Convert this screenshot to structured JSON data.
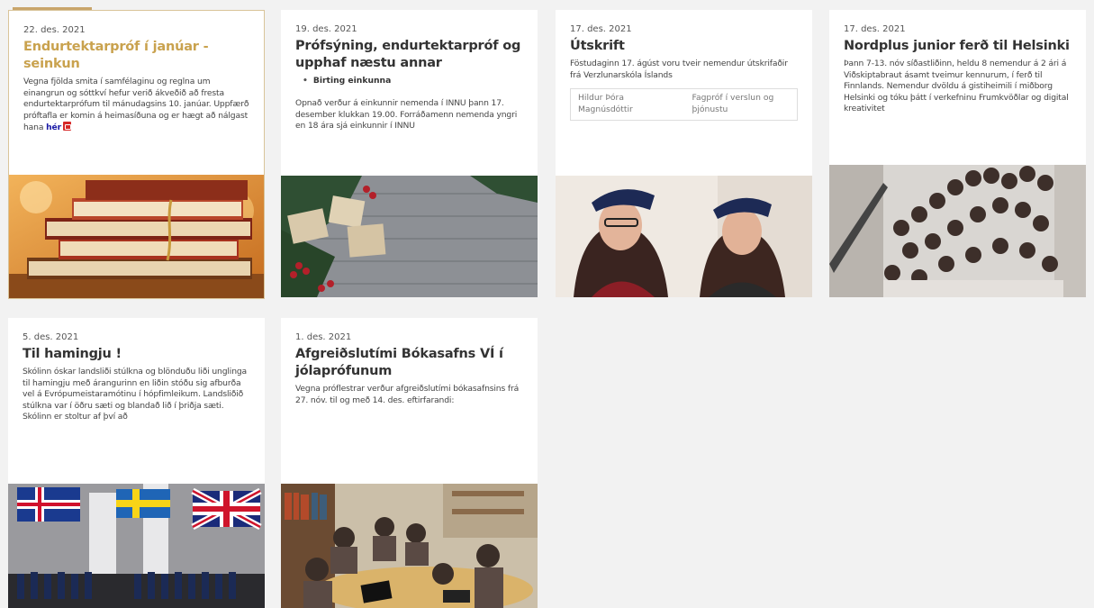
{
  "news": [
    {
      "date": "22. des. 2021",
      "title": "Endurtektarpróf í janúar - seinkun",
      "text": "Vegna fjölda smita í samfélaginu og reglna um einangrun og sóttkví hefur verið ákveðið að fresta endurtektarprófum til mánudagsins 10. janúar. Uppfærð próftafla er komin á heimasíðuna og er hægt að nálgast hana",
      "link_label": "hér",
      "image_icon": "books-icon"
    },
    {
      "date": "19. des. 2021",
      "title": "Prófsýning, endurtektarpróf og upphaf næstu annar",
      "bullet": "Birting einkunna",
      "text": "Opnað verður á einkunnir nemenda í INNU þann 17. desember klukkan 19.00. Forráðamenn nemenda yngri en 18 ára sjá einkunnir í INNU",
      "image_icon": "christmas-gifts-icon"
    },
    {
      "date": "17. des. 2021",
      "title": "Útskrift",
      "text": "Föstudaginn 17. ágúst voru tveir nemendur útskrifaðir frá Verzlunarskóla Íslands",
      "table": [
        [
          "Hildur Þóra",
          "Fagpróf í verslun og"
        ],
        [
          "Magnúsdóttir",
          "þjónustu"
        ]
      ],
      "image_icon": "graduates-icon"
    },
    {
      "date": "17. des. 2021",
      "title": "Nordplus junior ferð til Helsinki",
      "text": "Þann 7-13. nóv síðastliðinn, heldu 8 nemendur á 2 ári á Viðskiptabraut ásamt tveimur kennurum, í ferð til Finnlands. Nemendur dvöldu á gistiheimili í miðborg Helsinki og tóku þátt í verkefninu Frumkvöðlar og digital kreativitet",
      "image_icon": "group-photo-icon"
    },
    {
      "date": "5. des. 2021",
      "title": "Til hamingju !",
      "text": "Skólinn óskar landsliði stúlkna og blönduðu liði unglinga til hamingju með árangurinn en liðin stóðu sig afburða vel á Evrópumeistaramótinu í hópfimleikum. Landsliðið stúlkna var í öðru sæti og blandað lið í þriðja sæti. Skólinn er stoltur af því að",
      "image_icon": "flags-gymnastics-icon"
    },
    {
      "date": "1. des. 2021",
      "title": "Afgreiðslutími Bókasafns VÍ í jólaprófunum",
      "text": "Vegna próflestrar verður afgreiðslutími bókasafnsins frá 27. nóv. til og með 14. des. eftirfarandi:",
      "image_icon": "library-students-icon"
    }
  ],
  "colors": {
    "accent": "#c9a24e",
    "background": "#f2f2f2",
    "card": "#ffffff",
    "link": "#1a1aa6"
  }
}
